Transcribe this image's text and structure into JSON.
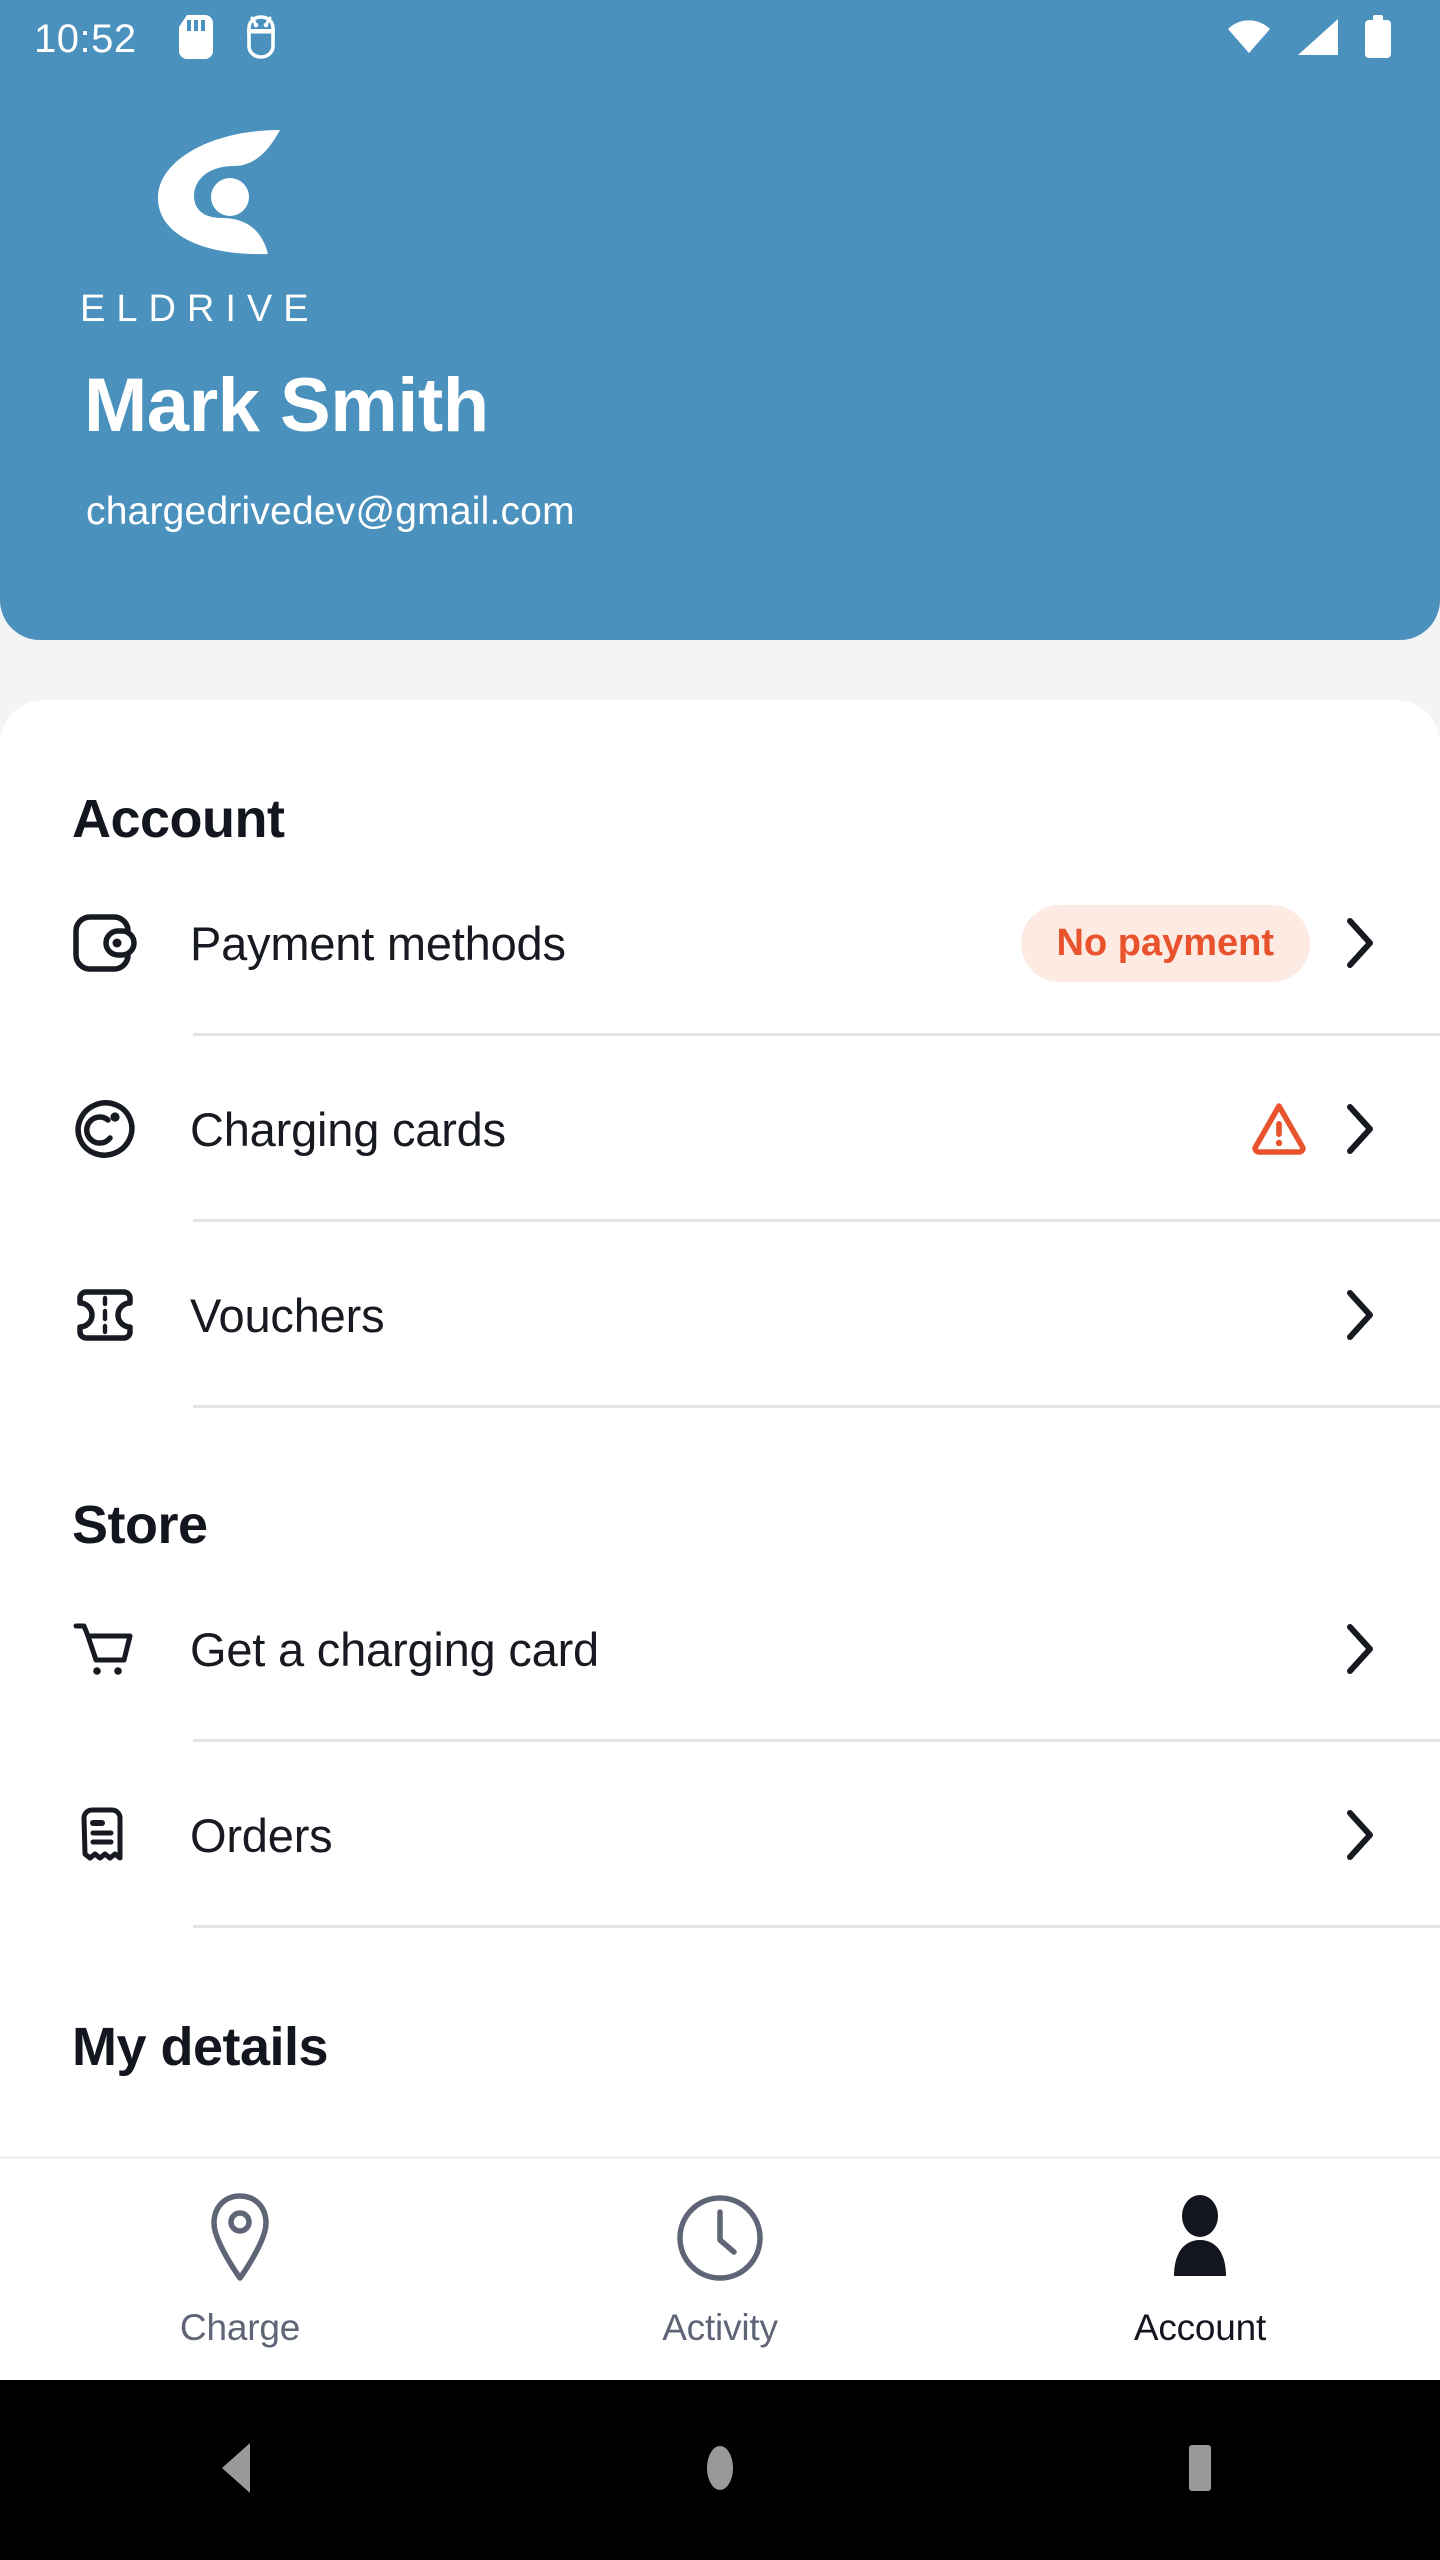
{
  "status_bar": {
    "time": "10:52",
    "left_icons": [
      "sd-card-icon",
      "android-debug-icon"
    ],
    "right_icons": [
      "wifi-icon",
      "cellular-signal-icon",
      "battery-icon"
    ]
  },
  "header": {
    "brand_name": "ELDRIVE",
    "logo": "eldrive-logo-icon",
    "user_name": "Mark Smith",
    "user_email": "chargedrivedev@gmail.com",
    "background_color": "#4a91bd"
  },
  "sections": [
    {
      "title": "Account",
      "rows": [
        {
          "icon": "wallet-icon",
          "label": "Payment methods",
          "badge": "No payment",
          "warning": false
        },
        {
          "icon": "charging-card-icon",
          "label": "Charging cards",
          "badge": "",
          "warning": true
        },
        {
          "icon": "voucher-ticket-icon",
          "label": "Vouchers",
          "badge": "",
          "warning": false
        }
      ]
    },
    {
      "title": "Store",
      "rows": [
        {
          "icon": "shopping-cart-icon",
          "label": "Get a charging card",
          "badge": "",
          "warning": false
        },
        {
          "icon": "receipt-icon",
          "label": "Orders",
          "badge": "",
          "warning": false
        }
      ]
    },
    {
      "title": "My details",
      "rows": []
    }
  ],
  "colors": {
    "accent_blue": "#4a91bd",
    "badge_background": "#fdeae3",
    "badge_text": "#e8522c",
    "warning": "#e8522c",
    "text_primary": "#14161f",
    "text_muted": "#5f6577",
    "divider": "#e2e4e8",
    "page_background": "#f2f4f6"
  },
  "bottom_nav": {
    "items": [
      {
        "label": "Charge",
        "icon": "map-pin-icon",
        "active": false
      },
      {
        "label": "Activity",
        "icon": "clock-icon",
        "active": false
      },
      {
        "label": "Account",
        "icon": "person-icon",
        "active": true
      }
    ]
  },
  "android_nav": {
    "buttons": [
      {
        "name": "back-button",
        "icon": "triangle-back-icon"
      },
      {
        "name": "home-button",
        "icon": "circle-home-icon"
      },
      {
        "name": "recents-button",
        "icon": "square-recents-icon"
      }
    ]
  }
}
